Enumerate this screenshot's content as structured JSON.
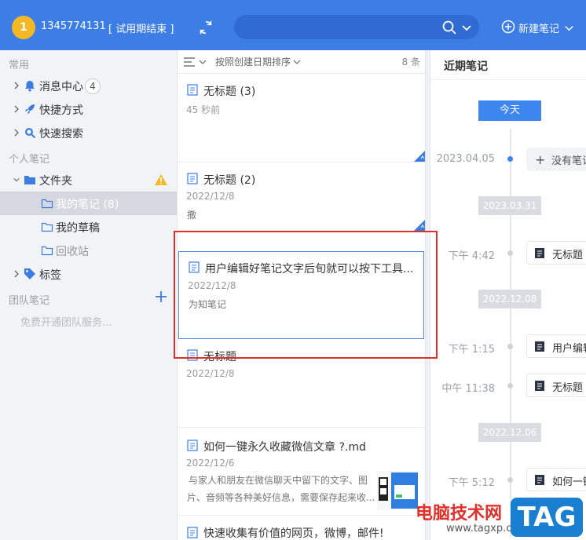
{
  "header": {
    "avatar_text": "1",
    "username": "1345774131",
    "trial_label": "[ 试用期结束 ]",
    "search_placeholder": "",
    "new_note_label": "新建笔记",
    "bg_color": "#3d7de6"
  },
  "sidebar": {
    "section_common": "常用",
    "messages": {
      "label": "消息中心",
      "count": "4"
    },
    "shortcuts": {
      "label": "快捷方式"
    },
    "quick_search": {
      "label": "快速搜索"
    },
    "section_personal": "个人笔记",
    "folder": {
      "label": "文件夹"
    },
    "my_notes": {
      "label": "我的笔记 (8)"
    },
    "my_drafts": {
      "label": "我的草稿"
    },
    "recycle": {
      "label": "回收站"
    },
    "tags": {
      "label": "标签"
    },
    "section_team": "团队笔记",
    "team_hint": "免费开通团队服务..."
  },
  "note_list": {
    "sort_label": "按照创建日期排序",
    "count": "8 条",
    "notes": [
      {
        "title": "无标题 (3)",
        "date": "45 秒前",
        "snippet": ""
      },
      {
        "title": "无标题 (2)",
        "date": "2022/12/8",
        "snippet": "撒"
      },
      {
        "title": "用户编辑好笔记文字后旬就可以按下工具...",
        "date": "2022/12/8",
        "snippet": "为知笔记"
      },
      {
        "title": "无标题",
        "date": "2022/12/8",
        "snippet": ""
      },
      {
        "title": "如何一键永久收藏微信文章 ?.md",
        "date": "2022/12/6",
        "snippet_line1": "与家人和朋友在微信聊天中留下的文字、图",
        "snippet_line2": "片、音频等各种美好信息，需要保存起来收..."
      },
      {
        "title": "快速收集有价值的网页，微博，邮件!",
        "date": "",
        "snippet": ""
      }
    ]
  },
  "recent": {
    "title": "近期笔记",
    "today": "今天",
    "entries": [
      {
        "time": "2023.04.05",
        "card": "没有笔记",
        "empty": true
      },
      {
        "chip": "2023.03.31"
      },
      {
        "time": "下午 4:42",
        "card": "无标题"
      },
      {
        "chip": "2022.12.08"
      },
      {
        "time": "下午 1:15",
        "card": "用户编辑"
      },
      {
        "time": "中午 11:38",
        "card": "无标题"
      },
      {
        "chip": "2022.12.06"
      },
      {
        "time": "下午 5:12",
        "card": "如何一键"
      }
    ]
  },
  "watermark": {
    "site_name": "电脑技术网",
    "url": "www.tagxp.com",
    "tag": "TAG"
  }
}
